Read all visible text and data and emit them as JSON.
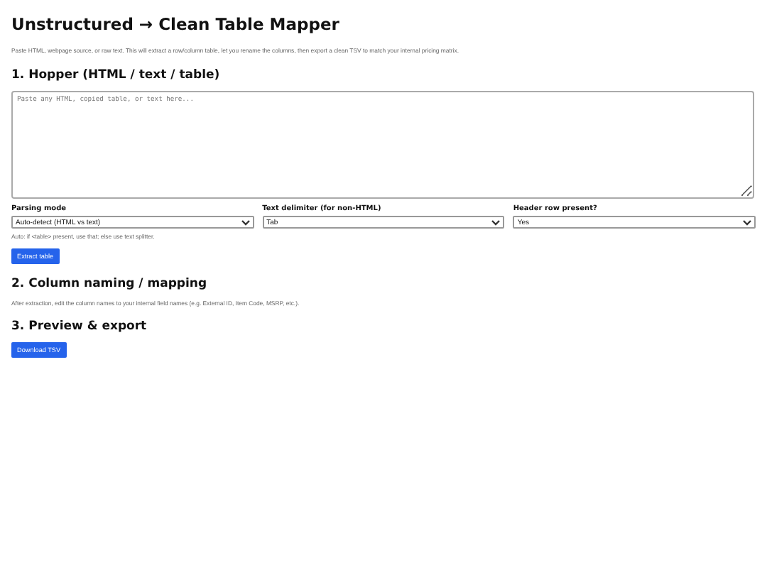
{
  "title": "Unstructured → Clean Table Mapper",
  "intro": "Paste HTML, webpage source, or raw text. This will extract a row/column table, let you rename the columns, then export a clean TSV to match your internal pricing matrix.",
  "hopper": {
    "heading": "1. Hopper (HTML / text / table)",
    "placeholder": "Paste any HTML, copied table, or text here...",
    "fields": [
      {
        "label": "Parsing mode",
        "value": "Auto-detect (HTML vs text)"
      },
      {
        "label": "Text delimiter (for non-HTML)",
        "value": "Tab"
      },
      {
        "label": "Header row present?",
        "value": "Yes"
      }
    ],
    "hint": "Auto: if <table> present, use that; else use text splitter.",
    "button": "Extract table"
  },
  "mapping": {
    "heading": "2. Column naming / mapping",
    "text": "After extraction, edit the column names to your internal field names (e.g. External ID, Item Code, MSRP, etc.)."
  },
  "export": {
    "heading": "3. Preview & export",
    "button": "Download TSV"
  }
}
